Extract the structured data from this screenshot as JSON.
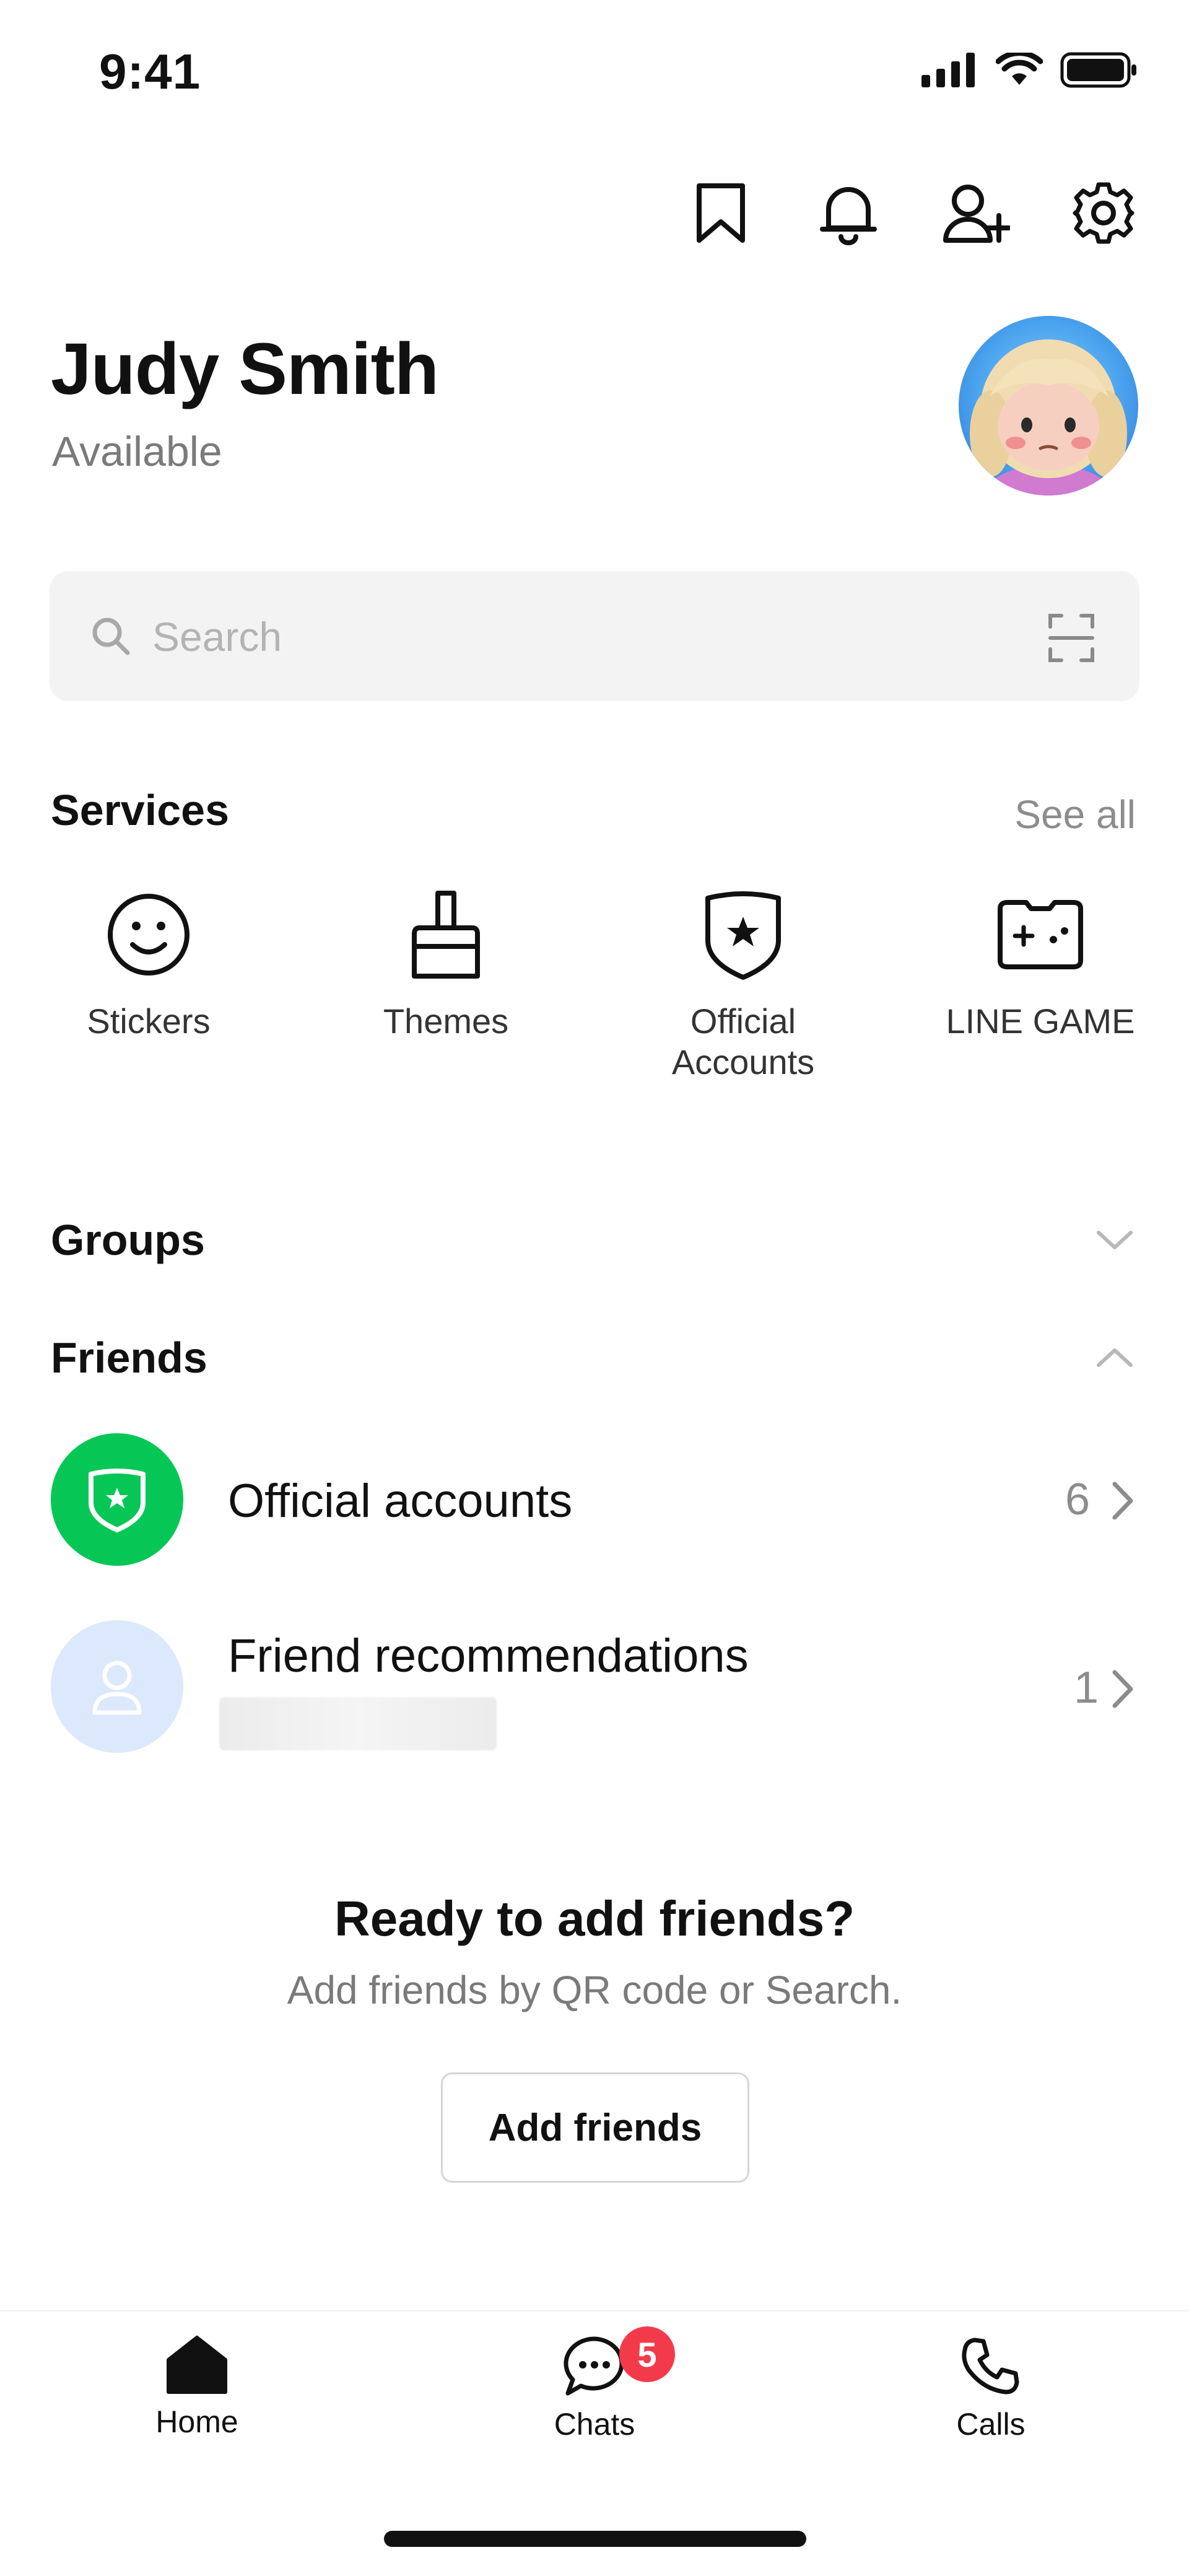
{
  "status_bar": {
    "time": "9:41"
  },
  "top_actions": [
    "bookmark-icon",
    "bell-icon",
    "add-friend-icon",
    "gear-icon"
  ],
  "profile": {
    "name": "Judy Smith",
    "status": "Available"
  },
  "search": {
    "placeholder": "Search"
  },
  "services": {
    "title": "Services",
    "see_all": "See all",
    "items": [
      {
        "label": "Stickers",
        "icon": "smiley-icon"
      },
      {
        "label": "Themes",
        "icon": "brush-icon"
      },
      {
        "label": "Official\nAccounts",
        "icon": "shield-star-icon"
      },
      {
        "label": "LINE GAME",
        "icon": "game-controller-icon"
      }
    ]
  },
  "groups": {
    "title": "Groups"
  },
  "friends": {
    "title": "Friends",
    "rows": [
      {
        "label": "Official accounts",
        "count": "6",
        "icon_color": "#06c755"
      },
      {
        "label": "Friend recommendations",
        "count": "1",
        "icon_color": "#dce8fb"
      }
    ]
  },
  "cta": {
    "title": "Ready to add friends?",
    "subtitle": "Add friends by QR code or Search.",
    "button": "Add friends"
  },
  "tabs": [
    {
      "label": "Home",
      "icon": "home-icon"
    },
    {
      "label": "Chats",
      "icon": "chat-icon",
      "badge": "5"
    },
    {
      "label": "Calls",
      "icon": "phone-icon"
    }
  ],
  "colors": {
    "accent_green": "#06c755",
    "badge_red": "#f33a4b"
  }
}
